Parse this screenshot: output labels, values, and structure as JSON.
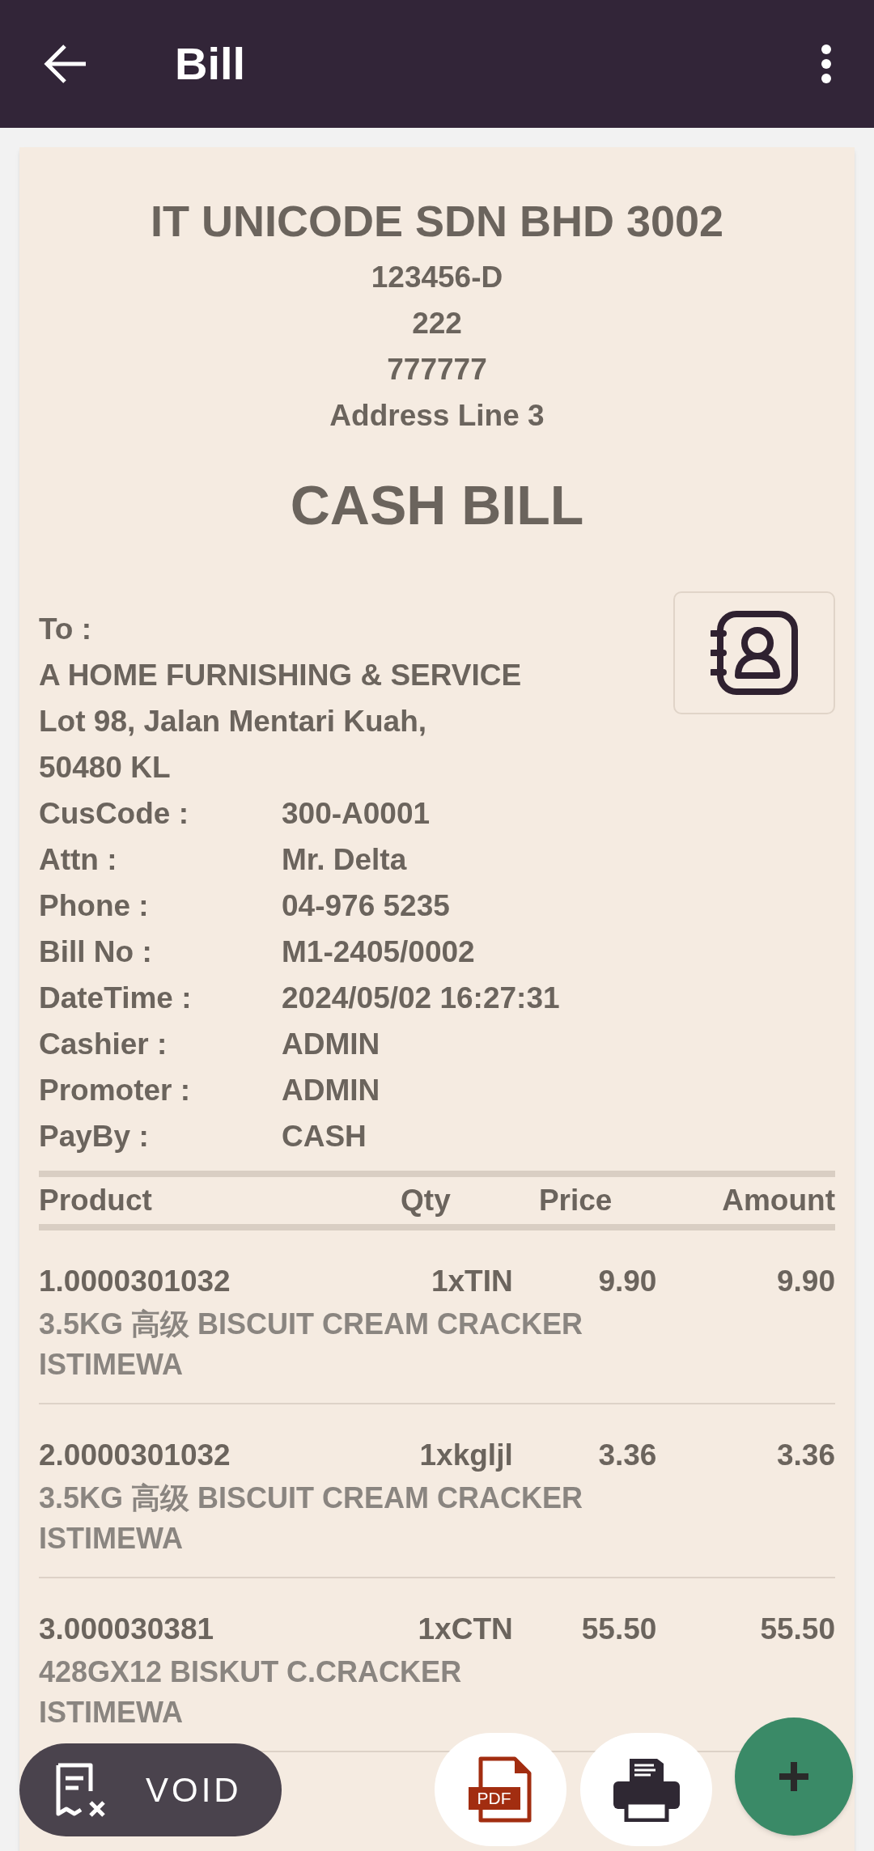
{
  "app_bar": {
    "title": "Bill"
  },
  "company": {
    "name": "IT UNICODE SDN BHD 3002",
    "lines": [
      "123456-D",
      "222",
      "777777",
      "Address Line 3"
    ]
  },
  "document_title": "CASH BILL",
  "customer": {
    "label": "To :",
    "lines": [
      "A HOME FURNISHING & SERVICE",
      "Lot 98, Jalan Mentari Kuah,",
      "50480 KL"
    ]
  },
  "fields": [
    {
      "label": "CusCode :",
      "value": "300-A0001"
    },
    {
      "label": "Attn :",
      "value": "Mr. Delta"
    },
    {
      "label": "Phone :",
      "value": "04-976 5235"
    },
    {
      "label": "Bill No :",
      "value": "M1-2405/0002"
    },
    {
      "label": "DateTime :",
      "value": "2024/05/02 16:27:31"
    },
    {
      "label": "Cashier :",
      "value": "ADMIN"
    },
    {
      "label": "Promoter :",
      "value": "ADMIN"
    },
    {
      "label": "PayBy :",
      "value": "CASH"
    }
  ],
  "table": {
    "columns": [
      "Product",
      "Qty",
      "Price",
      "Amount"
    ],
    "rows": [
      {
        "code": "1.0000301032",
        "qty": "1xTIN",
        "price": "9.90",
        "amount": "9.90",
        "description": "3.5KG 高级 BISCUIT CREAM CRACKER ISTIMEWA"
      },
      {
        "code": "2.0000301032",
        "qty": "1xkgljl",
        "price": "3.36",
        "amount": "3.36",
        "description": "3.5KG 高级 BISCUIT CREAM CRACKER ISTIMEWA"
      },
      {
        "code": "3.000030381",
        "qty": "1xCTN",
        "price": "55.50",
        "amount": "55.50",
        "description": "428GX12 BISKUT C.CRACKER ISTIMEWA"
      }
    ]
  },
  "actions": {
    "void_label": "VOID",
    "pdf_label": "PDF"
  }
}
